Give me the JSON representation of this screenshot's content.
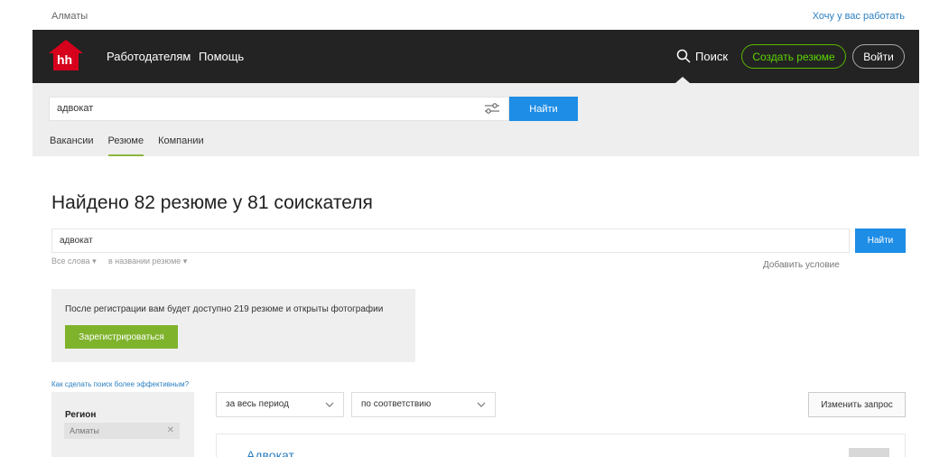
{
  "topstrip": {
    "city": "Алматы",
    "employer_link": "Хочу у вас работать"
  },
  "header": {
    "logo_text": "hh",
    "nav": {
      "employers": "Работодателям",
      "help": "Помощь"
    },
    "search_label": "Поиск",
    "create_resume": "Создать резюме",
    "login": "Войти"
  },
  "search": {
    "query": "адвокат",
    "find_label": "Найти",
    "tabs": [
      {
        "label": "Вакансии",
        "active": false
      },
      {
        "label": "Резюме",
        "active": true
      },
      {
        "label": "Компании",
        "active": false
      }
    ]
  },
  "results": {
    "title": "Найдено 82 резюме у 81 соискателя",
    "query": "адвокат",
    "find_label": "Найти",
    "word_mode": "Все слова",
    "search_scope": "в названии резюме",
    "add_condition": "Добавить условие"
  },
  "registration": {
    "text": "После регистрации вам будет доступно 219 резюме и открыты фотографии",
    "button": "Зарегистрироваться"
  },
  "tips_link": "Как сделать поиск более эффективным?",
  "filters": {
    "region_title": "Регион",
    "region_value": "Алматы",
    "period": "за весь период",
    "sort": "по соответствию",
    "change_query": "Изменить запрос"
  },
  "result_items": [
    {
      "title": "Адвокат"
    }
  ],
  "colors": {
    "header_bg": "#232323",
    "logo_red": "#d6001c",
    "brand_green": "#5cd700",
    "button_blue": "#1e8de6",
    "register_green": "#7fb32c",
    "link_blue": "#2b7fc1"
  },
  "icons": {
    "search": "magnifier-icon",
    "filter": "sliders-icon",
    "chevron": "chevron-down-icon",
    "remove": "close-icon"
  }
}
